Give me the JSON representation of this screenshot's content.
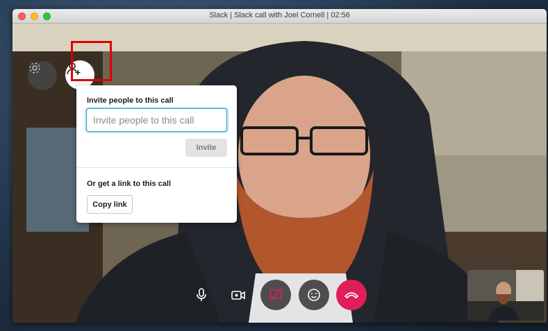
{
  "window": {
    "title": "Slack | Slack call with Joel Cornell | 02:56"
  },
  "top_controls": {
    "settings_icon": "gear-icon",
    "invite_icon": "add-person-icon"
  },
  "invite_popover": {
    "heading": "Invite people to this call",
    "input_placeholder": "Invite people to this call",
    "input_value": "",
    "invite_button": "Invite",
    "link_heading": "Or get a link to this call",
    "copy_link_button": "Copy link"
  },
  "call_controls": [
    {
      "name": "microphone",
      "icon": "microphone-icon"
    },
    {
      "name": "camera",
      "icon": "video-camera-icon"
    },
    {
      "name": "screen-share",
      "icon": "screen-share-off-icon"
    },
    {
      "name": "reactions",
      "icon": "smiley-icon"
    },
    {
      "name": "hang-up",
      "icon": "hang-up-icon"
    }
  ],
  "colors": {
    "accent_blue": "#1d9bd1",
    "hangup_red": "#e01e5a",
    "highlight_red": "#e00000"
  }
}
